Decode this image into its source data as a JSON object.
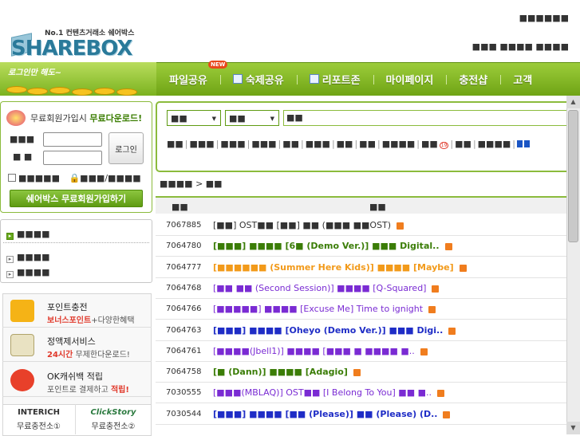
{
  "brand": {
    "logo_tagline": "No.1 컨텐츠거래소 쉐어박스",
    "logo_text": "SHAREBOX"
  },
  "header": {
    "top_util": "■■■■■■",
    "util_links": "■■■ ■■■■ ■■■■"
  },
  "nav": {
    "promo_text": "로그인만 해도~",
    "new_badge": "NEW",
    "items": [
      {
        "label": "파일공유",
        "icon": ""
      },
      {
        "label": "숙제공유",
        "icon": "homework-icon"
      },
      {
        "label": "리포트존",
        "icon": "report-icon"
      },
      {
        "label": "마이페이지",
        "icon": ""
      },
      {
        "label": "충전샵",
        "icon": ""
      },
      {
        "label": "고객",
        "icon": ""
      }
    ]
  },
  "login": {
    "promo_prefix": "무료회원가입시",
    "promo_highlight": "무료다운로드!",
    "id_label": "■■■",
    "pw_label": "■ ■",
    "login_button": "로그인",
    "remember_label": "■■■■■",
    "secure_label": "■■■/■■■■",
    "join_button": "쉐어박스 무료회원가입하기"
  },
  "categories": {
    "header": "■■■■",
    "items": [
      "■■■■",
      "■■■■"
    ]
  },
  "services": [
    {
      "title": "포인트충전",
      "sub_em": "보너스포인트",
      "sub_rest": "+다양한혜택",
      "icon": "coin-stack-icon",
      "color": "#f5b316"
    },
    {
      "title": "정액제서비스",
      "sub_em": "24시간",
      "sub_rest": " 무제한다운로드!",
      "icon": "calendar-icon",
      "color": "#e9e2c2"
    },
    {
      "title": "OK캐쉬백 적립",
      "sub_em": "적립!",
      "sub_rest": "포인트로 결제하고 ",
      "icon": "ok-cashbag-icon",
      "color": "#e8402a"
    }
  ],
  "partners": [
    {
      "logo": "INTERICH",
      "label": "무료충전소①"
    },
    {
      "logo": "ClickStory",
      "label": "무료충전소②"
    }
  ],
  "search": {
    "select1": "■■",
    "select2": "■■",
    "input_value": "■■",
    "keywords": [
      "■■",
      "■■■",
      "■■■",
      "■■■",
      "■■",
      "■■■",
      "■■",
      "■■",
      "■■■■",
      "■■",
      "■■",
      "■■■■"
    ],
    "age_badge": "19"
  },
  "list": {
    "breadcrumb": "■■■■ > ■■",
    "header_col1": "■■",
    "header_col2": "■■",
    "rows": [
      {
        "id": "7067885",
        "style": "normal",
        "title": "[■■] OST■■ [■■] ■■ (■■■ ■■OST)",
        "flag": true
      },
      {
        "id": "7064780",
        "style": "green",
        "title": "[■■■] ■■■■ [6■ (Demo Ver.)] ■■■ Digital..",
        "flag": true
      },
      {
        "id": "7064777",
        "style": "orange",
        "title": "[■■■■■■ (Summer Here Kids)] ■■■■ [Maybe]",
        "flag": true
      },
      {
        "id": "7064768",
        "style": "purple",
        "title": "[■■ ■■ (Second Session)] ■■■■ [Q-Squared]",
        "flag": true
      },
      {
        "id": "7064766",
        "style": "purple",
        "title": "[■■■■■] ■■■■ [Excuse Me] Time to ignight",
        "flag": true
      },
      {
        "id": "7064763",
        "style": "blue",
        "title": "[■■■] ■■■■ [Oheyo (Demo Ver.)] ■■■ Digi..",
        "flag": true
      },
      {
        "id": "7064761",
        "style": "purple",
        "title": "[■■■■(Jbell1)] ■■■■ [■■■ ■ ■■■■ ■..",
        "flag": true
      },
      {
        "id": "7064758",
        "style": "green",
        "title": "[■ (Dann)] ■■■■ [Adagio]",
        "flag": true
      },
      {
        "id": "7030555",
        "style": "purple",
        "title": "[■■■(MBLAQ)] OST■■ [I Belong To You] ■■ ■..",
        "flag": true
      },
      {
        "id": "7030544",
        "style": "blue",
        "title": "[■■■] ■■■■ [■■ (Please)] ■■ (Please) (D..",
        "flag": true
      }
    ]
  }
}
